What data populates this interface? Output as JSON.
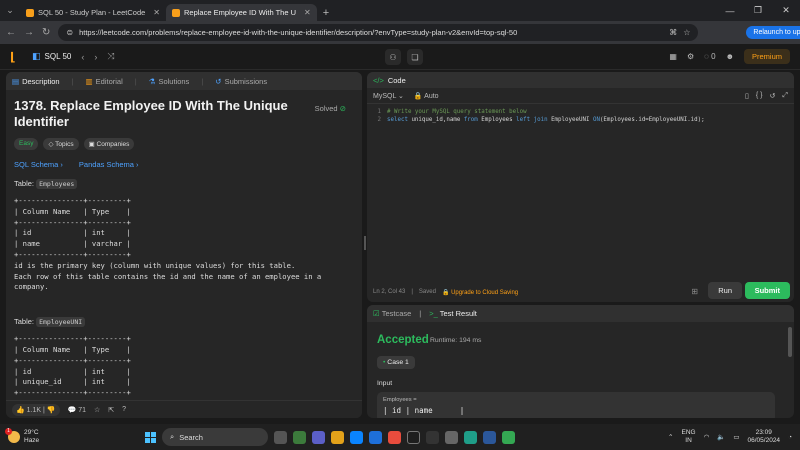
{
  "browser": {
    "tabs": [
      {
        "label": "SQL 50 - Study Plan - LeetCode",
        "active": false
      },
      {
        "label": "Replace Employee ID With The U",
        "active": true
      }
    ],
    "url": "https://leetcode.com/problems/replace-employee-id-with-the-unique-identifier/description/?envType=study-plan-v2&envId=top-sql-50",
    "relaunch_label": "Relaunch to update"
  },
  "lc_header": {
    "study_plan": "SQL 50",
    "coins": "0",
    "premium_label": "Premium"
  },
  "left": {
    "tabs": [
      "Description",
      "Editorial",
      "Solutions",
      "Submissions"
    ],
    "title": "1378. Replace Employee ID With The Unique Identifier",
    "solved_label": "Solved",
    "tags": [
      "Easy",
      "Topics",
      "Companies"
    ],
    "schema_links": [
      "SQL Schema",
      "Pandas Schema"
    ],
    "table1_label": "Table:",
    "table1_name": "Employees",
    "table1_text": "+---------------+---------+\n| Column Name   | Type    |\n+---------------+---------+\n| id            | int     |\n| name          | varchar |\n+---------------+---------+\nid is the primary key (column with unique values) for this table.\nEach row of this table contains the id and the name of an employee in a\ncompany.",
    "table2_label": "Table:",
    "table2_name": "EmployeeUNI",
    "table2_text": "+---------------+---------+\n| Column Name   | Type    |\n+---------------+---------+\n| id            | int     |\n| unique_id     | int     |\n+---------------+---------+",
    "likes": "1.1K",
    "comments": "71"
  },
  "code": {
    "header": "Code",
    "language": "MySQL",
    "mode": "Auto",
    "line1_num": "1",
    "line1": "# Write your MySQL query statement below",
    "line2_num": "2",
    "line2": {
      "kw1": "select",
      "t1": " unique_id,name ",
      "kw2": "from",
      "t2": " Employees ",
      "kw3": "left join",
      "t3": " EmployeeUNI ",
      "kw4": "ON",
      "t4": "(Employees.id=EmployeeUNI.id);"
    },
    "position": "Ln 2, Col 43",
    "saved": "Saved",
    "upgrade": "Upgrade to Cloud Saving",
    "run_label": "Run",
    "submit_label": "Submit"
  },
  "test": {
    "tabs": [
      "Testcase",
      "Test Result"
    ],
    "status": "Accepted",
    "runtime": "Runtime: 194 ms",
    "case_label": "Case 1",
    "input_label": "Input",
    "input_name": "Employees =",
    "input_preview": "| id | name      |"
  },
  "taskbar": {
    "temp": "29°C",
    "weather": "Haze",
    "badge": "1",
    "search_label": "Search",
    "lang1": "ENG",
    "lang2": "IN",
    "time": "23:09",
    "date": "06/05/2024"
  }
}
